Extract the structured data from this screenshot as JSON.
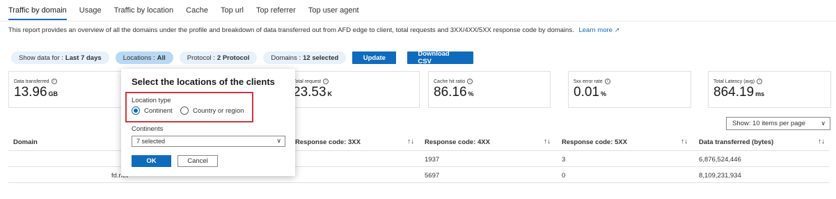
{
  "tabs": [
    "Traffic by domain",
    "Usage",
    "Traffic by location",
    "Cache",
    "Top url",
    "Top referrer",
    "Top user agent"
  ],
  "description": "This report provides an overview of all the domains under the profile and breakdown of data transferred out from AFD edge to client, total requests and 3XX/4XX/5XX response code by domains.",
  "learn_more": "Learn more",
  "filters": {
    "show_data": {
      "label": "Show data for :",
      "value": "Last 7 days"
    },
    "locations": {
      "label": "Locations :",
      "value": "All"
    },
    "protocol": {
      "label": "Protocol :",
      "value": "2 Protocol"
    },
    "domains": {
      "label": "Domains :",
      "value": "12 selected"
    },
    "update": "Update",
    "download": "Download CSV"
  },
  "cards": [
    {
      "label": "Data transferred",
      "value": "13.96",
      "unit": "GB"
    },
    {
      "label": "Total request",
      "value": "23.53",
      "unit": "K"
    },
    {
      "label": "Cache hit ratio",
      "value": "86.16",
      "unit": "%"
    },
    {
      "label": "5xx error rate",
      "value": "0.01",
      "unit": "%"
    },
    {
      "label": "Total Latency (avg)",
      "value": "864.19",
      "unit": "ms"
    }
  ],
  "page_size": "Show: 10 items per page",
  "table": {
    "headers": [
      "Domain",
      "Response code: 3XX",
      "Response code: 4XX",
      "Response code: 5XX",
      "Data transferred (bytes)"
    ],
    "rows": [
      {
        "domain": "",
        "c3": "",
        "c4": "1937",
        "c5": "3",
        "bytes": "6,876,524,446"
      },
      {
        "domain": "fd.net",
        "c3": "",
        "c4": "5697",
        "c5": "0",
        "bytes": "8,109,231,934"
      }
    ]
  },
  "popup": {
    "title": "Select the locations of the clients",
    "location_type_label": "Location type",
    "options": [
      "Continent",
      "Country or region"
    ],
    "selected_option": "Continent",
    "continents_label": "Continents",
    "continents_value": "7 selected",
    "ok": "OK",
    "cancel": "Cancel"
  }
}
